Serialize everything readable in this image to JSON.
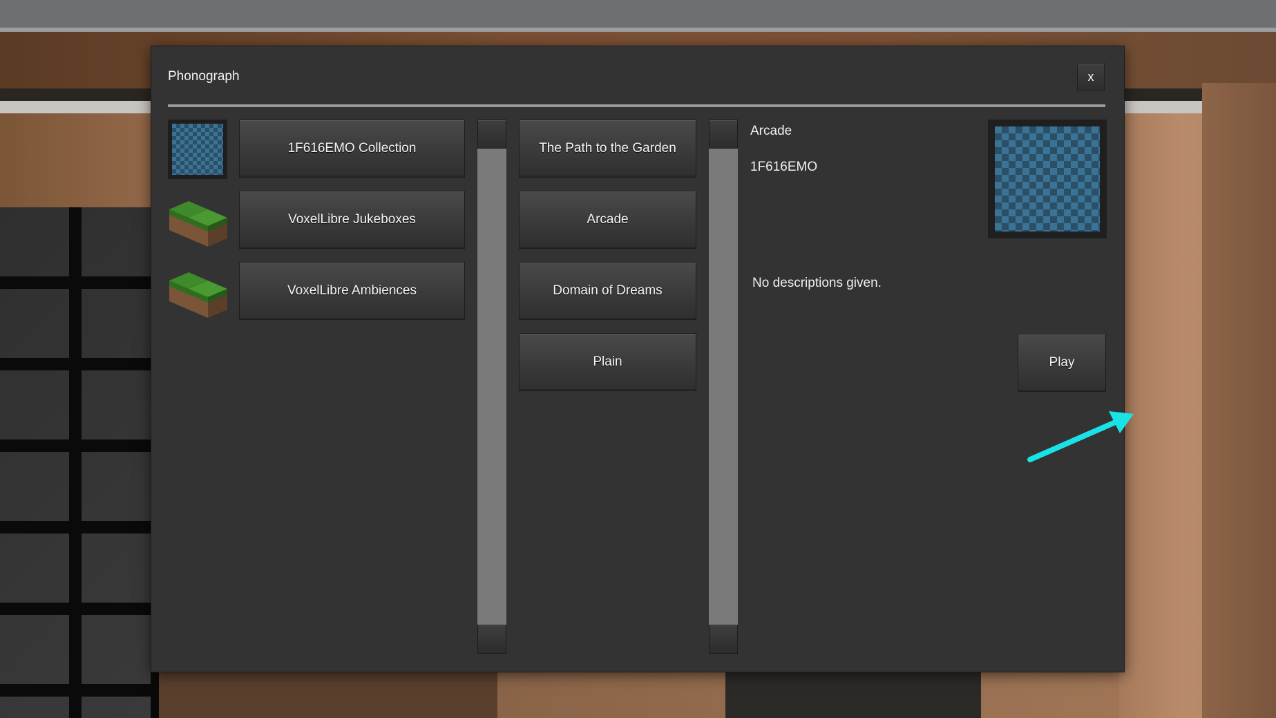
{
  "dialog": {
    "title": "Phonograph",
    "close_label": "x"
  },
  "collections": [
    {
      "label": "1F616EMO Collection",
      "icon": "checker-art-icon"
    },
    {
      "label": "VoxelLibre Jukeboxes",
      "icon": "grass-block-icon"
    },
    {
      "label": "VoxelLibre Ambiences",
      "icon": "grass-block-icon"
    }
  ],
  "songs": [
    {
      "label": "The Path to the Garden"
    },
    {
      "label": "Arcade"
    },
    {
      "label": "Domain of Dreams"
    },
    {
      "label": "Plain"
    }
  ],
  "details": {
    "song_title": "Arcade",
    "artist": "1F616EMO",
    "description": "No descriptions given.",
    "play_label": "Play"
  },
  "colors": {
    "panel": "#333333",
    "accent_arrow": "#19e3e6",
    "checker_light": "#3b7396",
    "checker_dark": "#2b4f66"
  }
}
